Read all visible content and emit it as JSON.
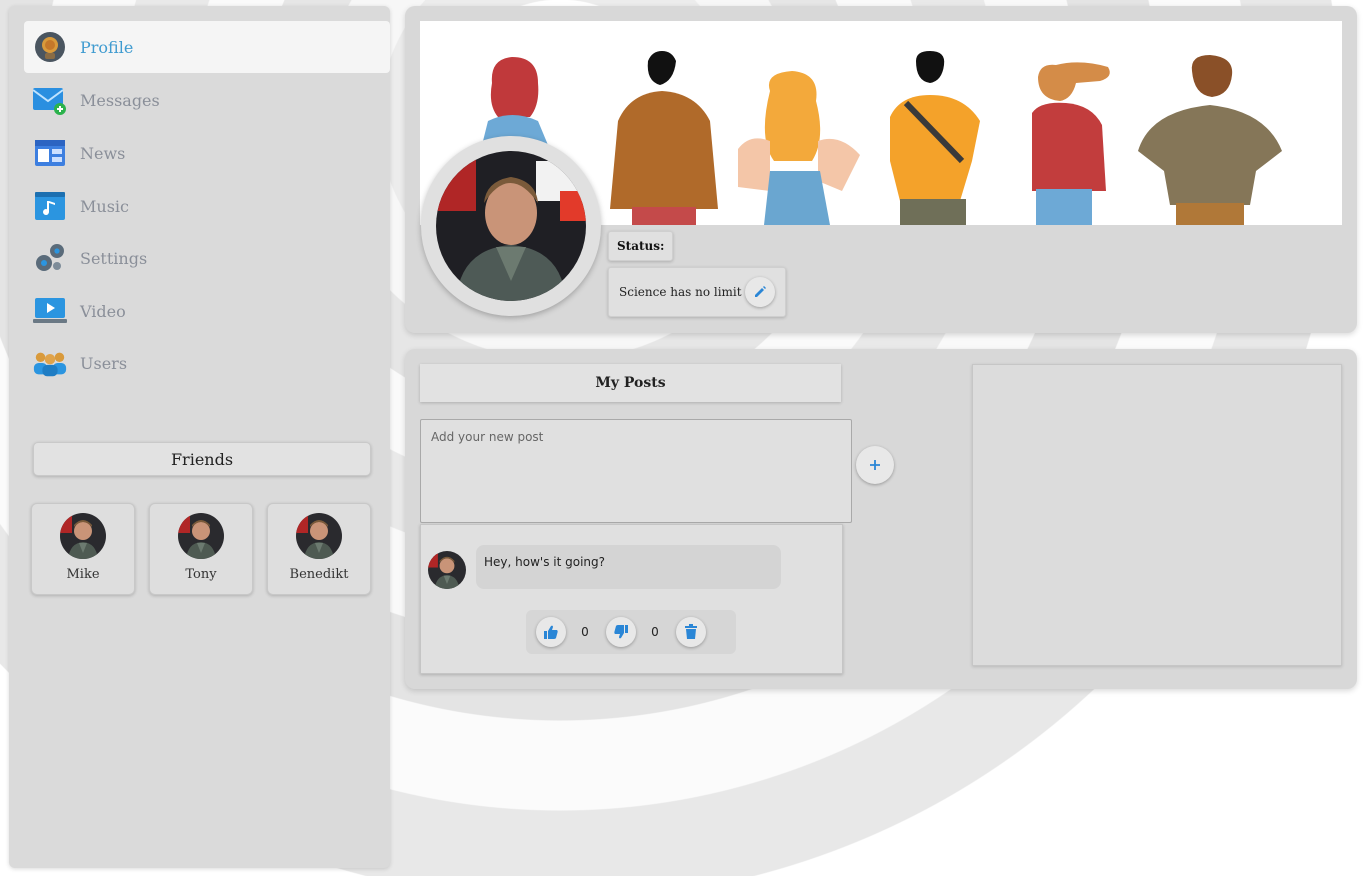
{
  "sidebar": {
    "items": [
      {
        "label": "Profile",
        "icon": "profile-icon",
        "active": true
      },
      {
        "label": "Messages",
        "icon": "messages-icon"
      },
      {
        "label": "News",
        "icon": "news-icon"
      },
      {
        "label": "Music",
        "icon": "music-icon"
      },
      {
        "label": "Settings",
        "icon": "settings-icon"
      },
      {
        "label": "Video",
        "icon": "video-icon"
      },
      {
        "label": "Users",
        "icon": "users-icon"
      }
    ],
    "friends_title": "Friends",
    "friends": [
      {
        "name": "Mike"
      },
      {
        "name": "Tony"
      },
      {
        "name": "Benedikt"
      }
    ]
  },
  "profile": {
    "status_label": "Status:",
    "status_text": "Science has no limit"
  },
  "posts": {
    "title": "My Posts",
    "input_placeholder": "Add your new post",
    "items": [
      {
        "message": "Hey, how's it going?",
        "likes": "0",
        "dislikes": "0"
      }
    ]
  },
  "colors": {
    "accent": "#3f9bd0",
    "button_blue": "#2a86d6"
  }
}
